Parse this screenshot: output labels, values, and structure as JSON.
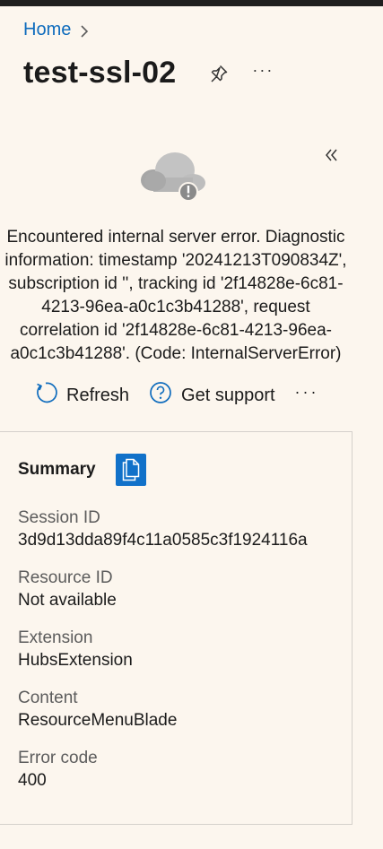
{
  "breadcrumb": {
    "home": "Home"
  },
  "page": {
    "title": "test-ssl-02"
  },
  "error": {
    "message": "Encountered internal server error. Diagnostic information: timestamp '20241213T090834Z', subscription id '', tracking id '2f14828e-6c81-4213-96ea-a0c1c3b41288', request correlation id '2f14828e-6c81-4213-96ea-a0c1c3b41288'. (Code: InternalServerError)"
  },
  "actions": {
    "refresh": "Refresh",
    "support": "Get support",
    "more": "···"
  },
  "summary": {
    "title": "Summary",
    "fields": [
      {
        "label": "Session ID",
        "value": "3d9d13dda89f4c11a0585c3f1924116a"
      },
      {
        "label": "Resource ID",
        "value": "Not available"
      },
      {
        "label": "Extension",
        "value": "HubsExtension"
      },
      {
        "label": "Content",
        "value": "ResourceMenuBlade"
      },
      {
        "label": "Error code",
        "value": "400"
      }
    ]
  },
  "colors": {
    "background": "#fcf6ee",
    "link": "#0f6cbd",
    "accent": "#1171c9",
    "muted": "#5c5c5c"
  }
}
